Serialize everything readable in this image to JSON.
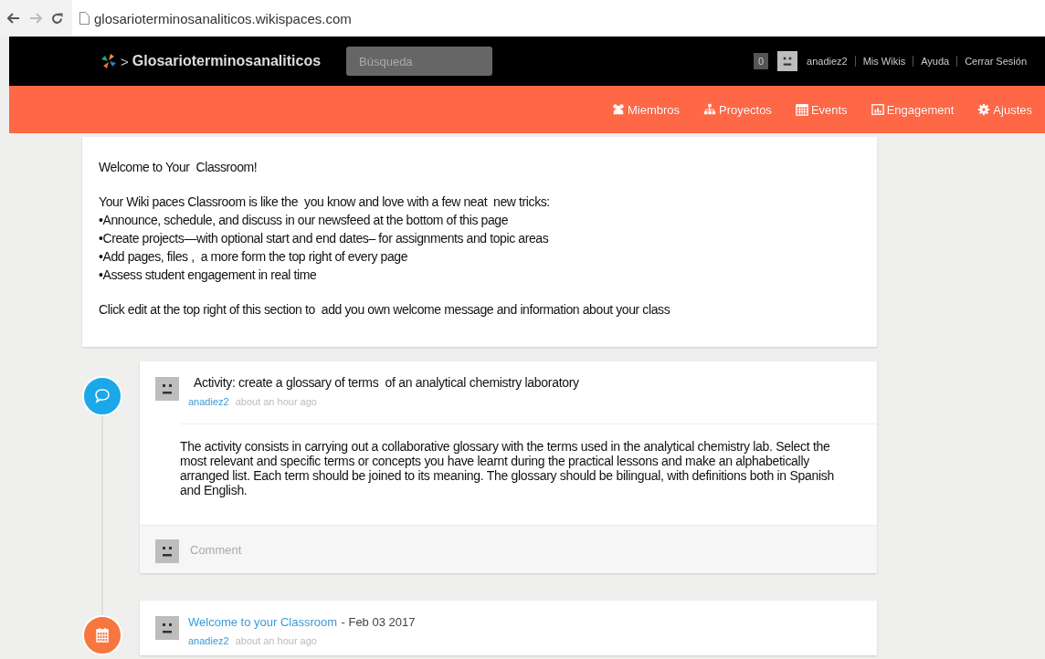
{
  "browser": {
    "url": "glosarioterminosanaliticos.wikispaces.com"
  },
  "header": {
    "site_name": "Glosarioterminosanaliticos",
    "separator": ">",
    "search": {
      "placeholder": "Búsqueda"
    },
    "notifications": "0",
    "user": "anadiez2",
    "links": [
      "Mis Wikis",
      "Ayuda",
      "Cerrar Sesión"
    ]
  },
  "nav": [
    {
      "kind": "members",
      "label": "Miembros"
    },
    {
      "kind": "projects",
      "label": "Proyectos"
    },
    {
      "kind": "events",
      "label": "Events"
    },
    {
      "kind": "engagement",
      "label": "Engagement"
    },
    {
      "kind": "settings",
      "label": "Ajustes"
    }
  ],
  "welcome": {
    "title": "Welcome to Your  Classroom!",
    "intro": "Your Wiki paces Classroom is like the  you know and love with a few neat  new tricks:",
    "bullets": [
      "•Announce, schedule, and discuss in our newsfeed at the bottom of this page",
      "•Create projects—with optional start and end dates– for assignments and topic areas",
      "•Add pages, files ,  a more form the top right of every page",
      "•Assess student engagement in real time"
    ],
    "footer": "Click edit at the top right of this section to  add you own welcome message and information about your class"
  },
  "feed": [
    {
      "kind": "discussion",
      "title": "Activity: create a glossary of terms  of an analytical chemistry laboratory",
      "author": "anadiez2",
      "time": "about an hour ago",
      "body": "The activity consists in carrying out a collaborative glossary with the terms used in the analytical chemistry lab. Select the most relevant and specific terms or concepts you have learnt during the practical lessons and make an alphabetically arranged list. Each term should be joined to its  meaning. The glossary should be bilingual, with definitions both in Spanish and English.",
      "comment_placeholder": "Comment"
    },
    {
      "kind": "event",
      "title": "Welcome to your Classroom",
      "date": "- Feb 03 2017",
      "author": "anadiez2",
      "time": "about an hour ago"
    }
  ]
}
